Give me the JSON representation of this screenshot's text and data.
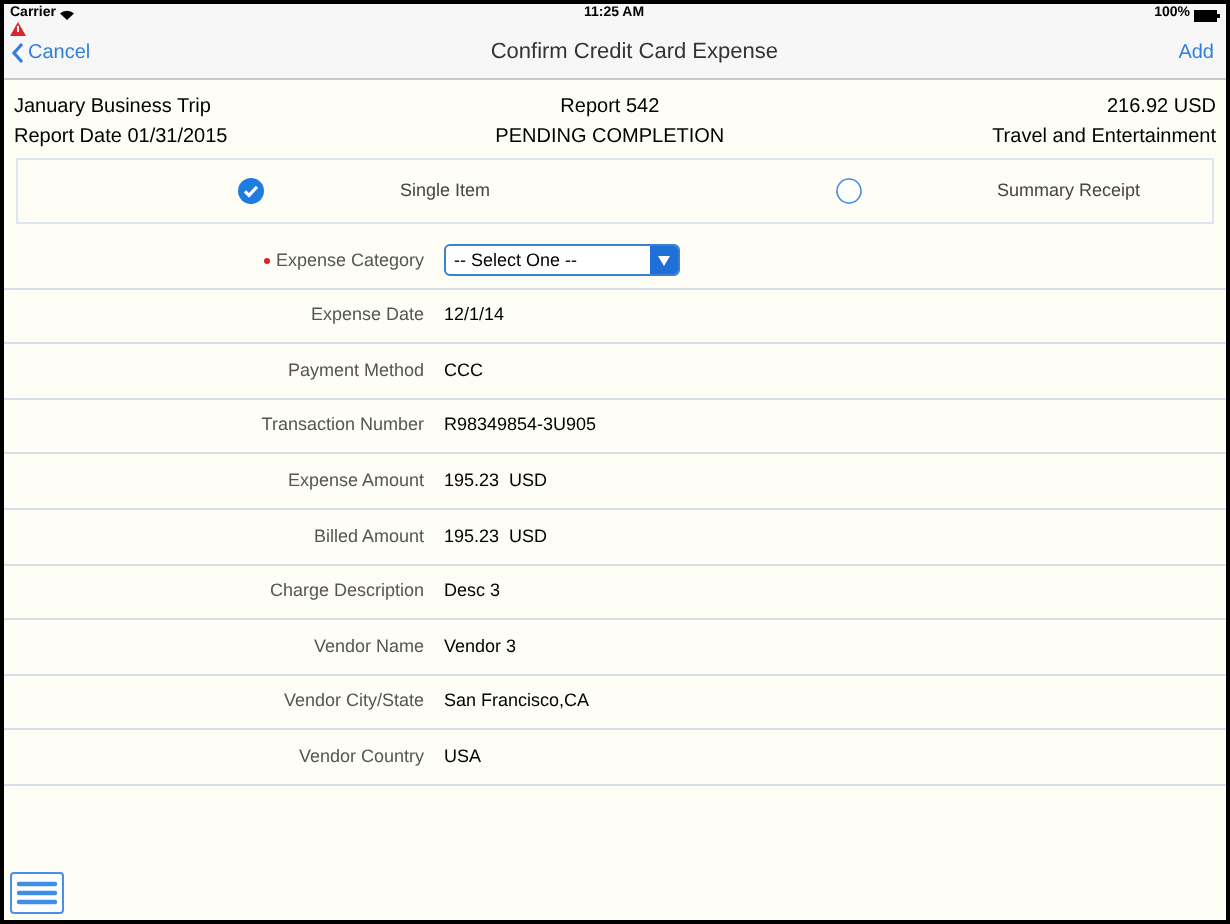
{
  "status_bar": {
    "carrier": "Carrier",
    "time": "11:25 AM",
    "battery": "100%"
  },
  "nav": {
    "back": "Cancel",
    "title": "Confirm Credit Card Expense",
    "action": "Add",
    "warning": true
  },
  "header": {
    "trip": "January Business Trip",
    "report_date": "Report Date 01/31/2015",
    "report": "Report 542",
    "status": "PENDING COMPLETION",
    "amount": "216.92 USD",
    "category": "Travel and Entertainment"
  },
  "receipt_options": [
    {
      "label": "Single Item",
      "selected": true
    },
    {
      "label": "Summary Receipt",
      "selected": false
    }
  ],
  "fields": [
    {
      "kind": "select",
      "label": "Expense Category",
      "required": true,
      "value": "-- Select One --"
    },
    {
      "kind": "text",
      "label": "Expense Date",
      "required": false,
      "value": "12/1/14"
    },
    {
      "kind": "text",
      "label": "Payment Method",
      "required": false,
      "value": "CCC"
    },
    {
      "kind": "text",
      "label": "Transaction Number",
      "required": false,
      "value": "R98349854-3U905"
    },
    {
      "kind": "text",
      "label": "Expense Amount",
      "required": false,
      "value": "195.23  USD"
    },
    {
      "kind": "text",
      "label": "Billed Amount",
      "required": false,
      "value": "195.23  USD"
    },
    {
      "kind": "text",
      "label": "Charge Description",
      "required": false,
      "value": "Desc 3"
    },
    {
      "kind": "text",
      "label": "Vendor Name",
      "required": false,
      "value": "Vendor 3"
    },
    {
      "kind": "text",
      "label": "Vendor City/State",
      "required": false,
      "value": "San Francisco,CA"
    },
    {
      "kind": "text",
      "label": "Vendor Country",
      "required": false,
      "value": "USA"
    }
  ]
}
